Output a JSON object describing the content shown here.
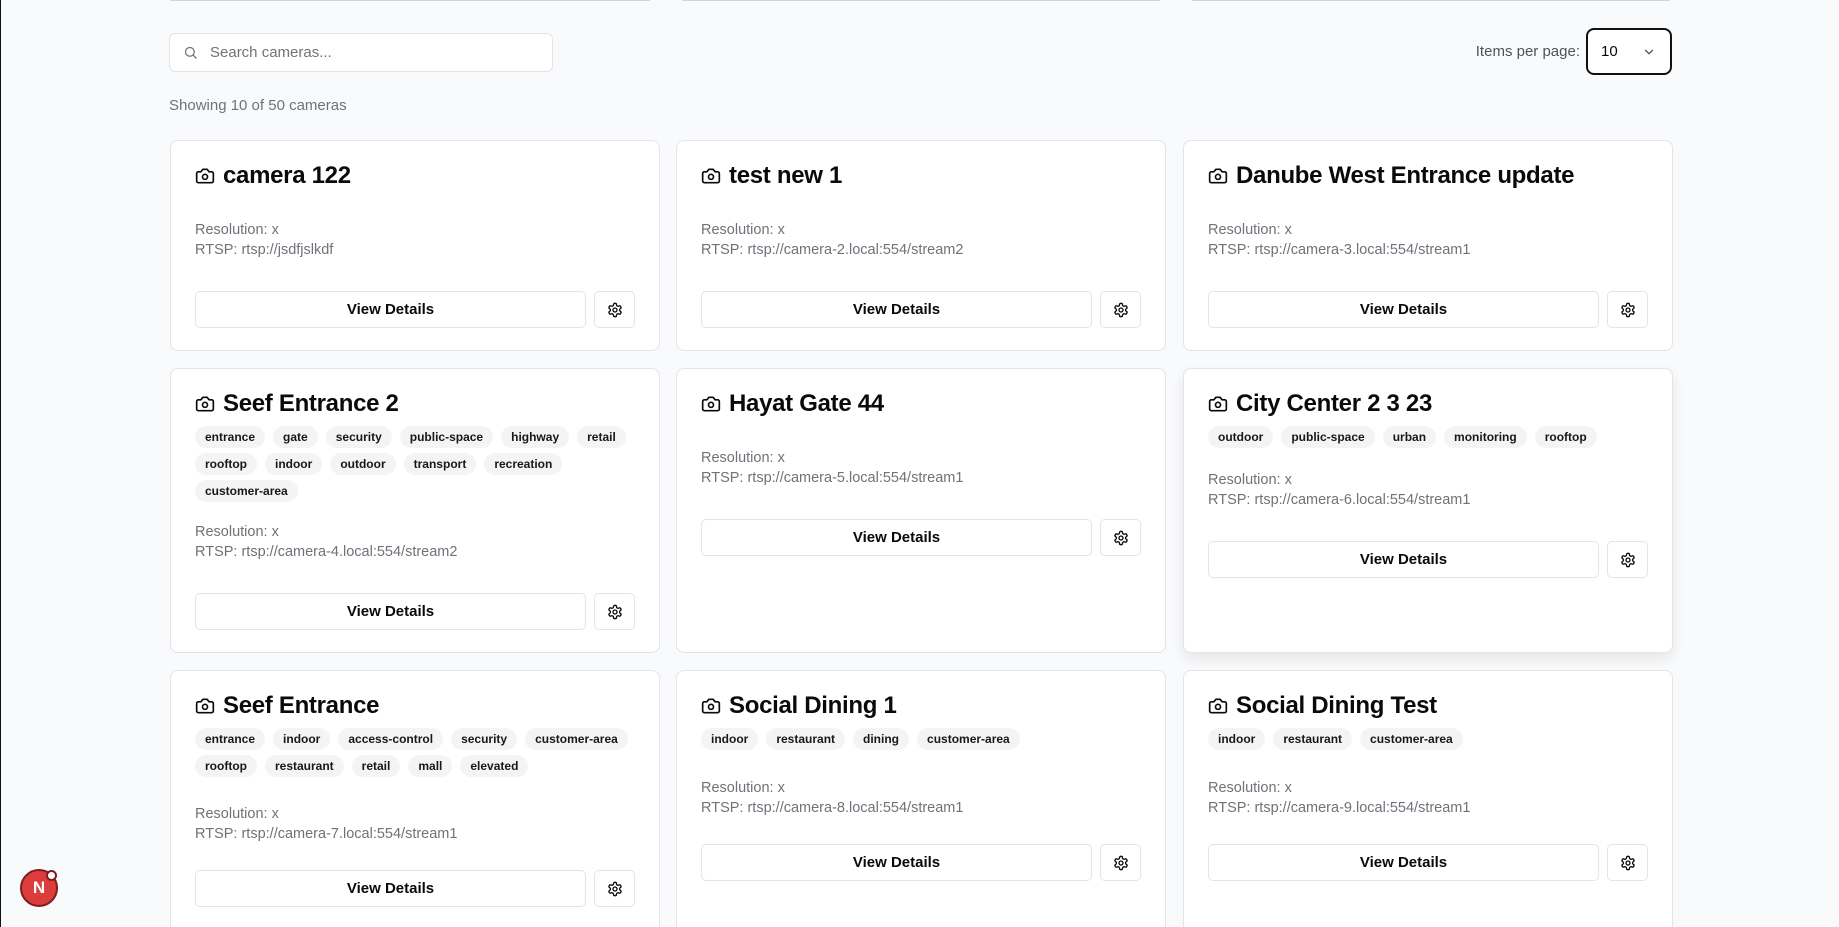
{
  "search": {
    "placeholder": "Search cameras..."
  },
  "pagination": {
    "label": "Items per page:",
    "value": "10"
  },
  "summary": "Showing 10 of 50 cameras",
  "buttons": {
    "view_details": "View Details"
  },
  "cameras": [
    {
      "name": "camera 122",
      "tags": [],
      "resolution": "Resolution: x",
      "rtsp": "RTSP: rtsp://jsdfjslkdf"
    },
    {
      "name": "test new 1",
      "tags": [],
      "resolution": "Resolution: x",
      "rtsp": "RTSP: rtsp://camera-2.local:554/stream2"
    },
    {
      "name": "Danube West Entrance update",
      "tags": [],
      "resolution": "Resolution: x",
      "rtsp": "RTSP: rtsp://camera-3.local:554/stream1"
    },
    {
      "name": "Seef Entrance 2",
      "tags": [
        "entrance",
        "gate",
        "security",
        "public-space",
        "highway",
        "retail",
        "rooftop",
        "indoor",
        "outdoor",
        "transport",
        "recreation",
        "customer-area"
      ],
      "resolution": "Resolution: x",
      "rtsp": "RTSP: rtsp://camera-4.local:554/stream2"
    },
    {
      "name": "Hayat Gate 44",
      "tags": [],
      "resolution": "Resolution: x",
      "rtsp": "RTSP: rtsp://camera-5.local:554/stream1"
    },
    {
      "name": "City Center 2 3 23",
      "tags": [
        "outdoor",
        "public-space",
        "urban",
        "monitoring",
        "rooftop"
      ],
      "resolution": "Resolution: x",
      "rtsp": "RTSP: rtsp://camera-6.local:554/stream1"
    },
    {
      "name": "Seef Entrance",
      "tags": [
        "entrance",
        "indoor",
        "access-control",
        "security",
        "customer-area",
        "rooftop",
        "restaurant",
        "retail",
        "mall",
        "elevated"
      ],
      "resolution": "Resolution: x",
      "rtsp": "RTSP: rtsp://camera-7.local:554/stream1"
    },
    {
      "name": "Social Dining 1",
      "tags": [
        "indoor",
        "restaurant",
        "dining",
        "customer-area"
      ],
      "resolution": "Resolution: x",
      "rtsp": "RTSP: rtsp://camera-8.local:554/stream1"
    },
    {
      "name": "Social Dining Test",
      "tags": [
        "indoor",
        "restaurant",
        "customer-area"
      ],
      "resolution": "Resolution: x",
      "rtsp": "RTSP: rtsp://camera-9.local:554/stream1"
    }
  ],
  "avatar": {
    "initial": "N"
  }
}
